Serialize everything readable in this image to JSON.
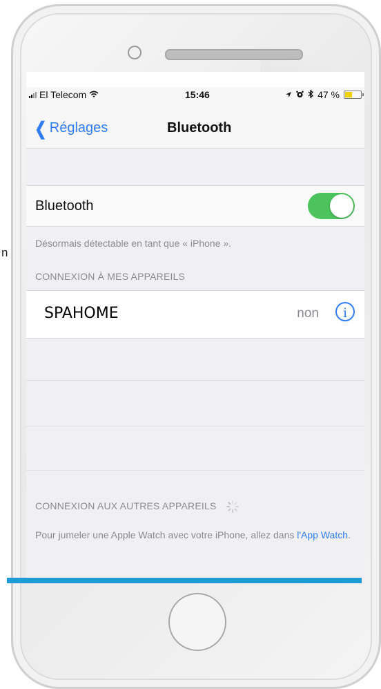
{
  "stray_text": "n",
  "status_bar": {
    "carrier": "El Telecom",
    "wifi_icon": "wifi-icon",
    "time": "15:46",
    "battery_percent": "47 %",
    "battery_level": 0.47,
    "battery_color": "#f0d200"
  },
  "nav": {
    "back_label": "Réglages",
    "title": "Bluetooth"
  },
  "bluetooth": {
    "label": "Bluetooth",
    "enabled": true,
    "toggle_color": "#4cc35c",
    "discoverable_note": "Désormais détectable en tant que « iPhone »."
  },
  "my_devices": {
    "header": "CONNEXION À MES APPAREILS",
    "devices": [
      {
        "name": "SPAHOME",
        "status": "non"
      }
    ]
  },
  "other_devices": {
    "header": "CONNEXION AUX AUTRES APPAREILS",
    "note_prefix": "Pour jumeler une Apple Watch avec votre iPhone, allez dans",
    "note_link": "l'App Watch",
    "note_suffix": "."
  },
  "colors": {
    "accent": "#2f7cf6",
    "bottom_band": "#1c9bd6"
  }
}
